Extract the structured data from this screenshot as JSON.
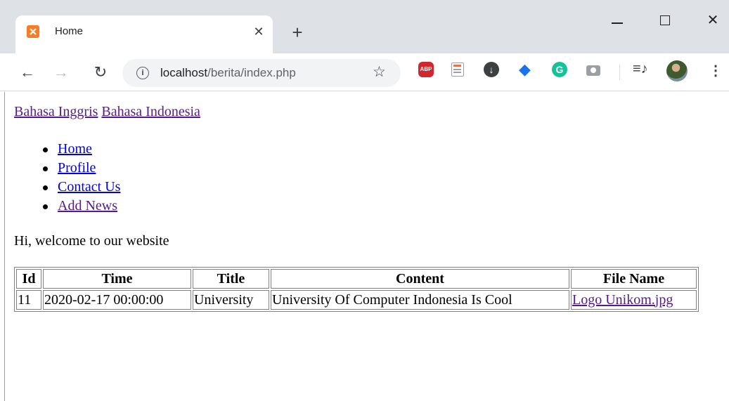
{
  "browser": {
    "tab": {
      "title": "Home",
      "favicon": "xampp-icon"
    },
    "new_tab_label": "+",
    "window_controls": {
      "minimize": "minimize-icon",
      "maximize": "maximize-icon",
      "close": "close-icon"
    },
    "toolbar": {
      "url_host": "localhost",
      "url_path": "/berita/index.php",
      "extensions": [
        "adblock-plus-icon",
        "notes-icon",
        "download-icon",
        "graduation-cap-icon",
        "grammarly-icon",
        "camera-icon",
        "media-controls-icon"
      ]
    }
  },
  "page": {
    "lang_links": [
      "Bahasa Inggris",
      "Bahasa Indonesia"
    ],
    "nav": [
      "Home",
      "Profile",
      "Contact Us",
      "Add News"
    ],
    "welcome": "Hi, welcome to our website",
    "table": {
      "headers": [
        "Id",
        "Time",
        "Title",
        "Content",
        "File Name"
      ],
      "rows": [
        [
          "11",
          "2020-02-17 00:00:00",
          "University",
          "University Of Computer Indonesia Is Cool",
          "Logo Unikom.jpg"
        ]
      ]
    }
  },
  "colors": {
    "link": "#0000ee",
    "visited_link": "#551a8b",
    "tabstrip": "#dee1e6",
    "omnibox": "#f1f3f4"
  }
}
